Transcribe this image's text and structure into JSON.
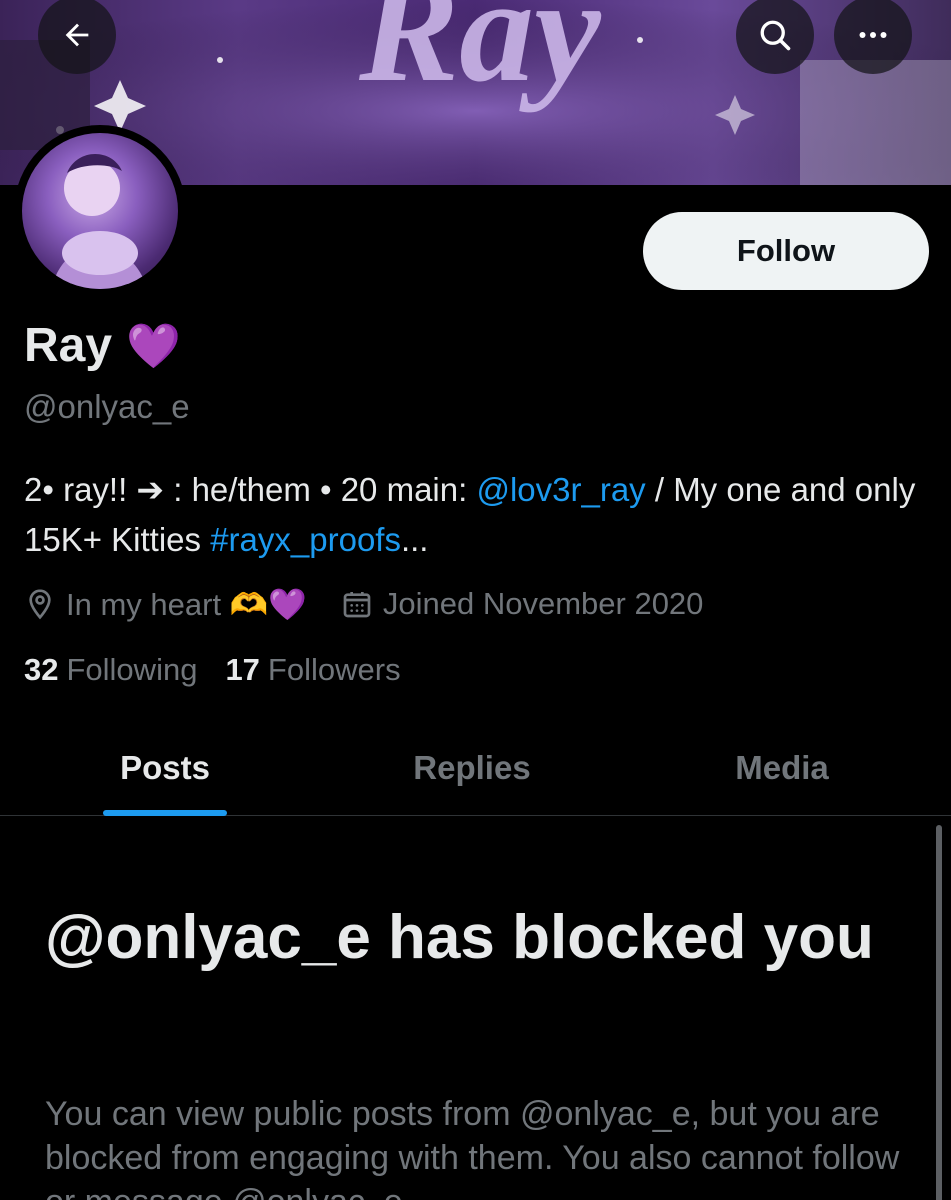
{
  "header": {
    "banner_text": "Ray",
    "back_icon": "arrow-left-icon",
    "search_icon": "search-icon",
    "more_icon": "more-horizontal-icon"
  },
  "profile": {
    "display_name": "Ray",
    "name_emoji": "💜",
    "handle": "@onlyac_e",
    "follow_label": "Follow",
    "bio": {
      "part1": "2• ray!! ➔ : he/them • 20 main: ",
      "link1": "@lov3r_ray",
      "part2": " / My one and only 15K+ Kitties ",
      "link2": "#rayx_proofs",
      "part3": "..."
    },
    "location": "In my heart 🫶💜",
    "joined": "Joined November 2020",
    "following_count": "32",
    "following_label": "Following",
    "followers_count": "17",
    "followers_label": "Followers"
  },
  "tabs": [
    {
      "label": "Posts",
      "active": true
    },
    {
      "label": "Replies",
      "active": false
    },
    {
      "label": "Media",
      "active": false
    }
  ],
  "blocked": {
    "title": "@onlyac_e has blocked you",
    "message": "You can view public posts from @onlyac_e, but you are blocked from engaging with them. You also cannot follow or message @onlyac_e."
  },
  "colors": {
    "background": "#000000",
    "text_primary": "#e7e9ea",
    "text_secondary": "#71767b",
    "accent": "#1d9bf0",
    "banner_purple": "#5a3a86"
  }
}
